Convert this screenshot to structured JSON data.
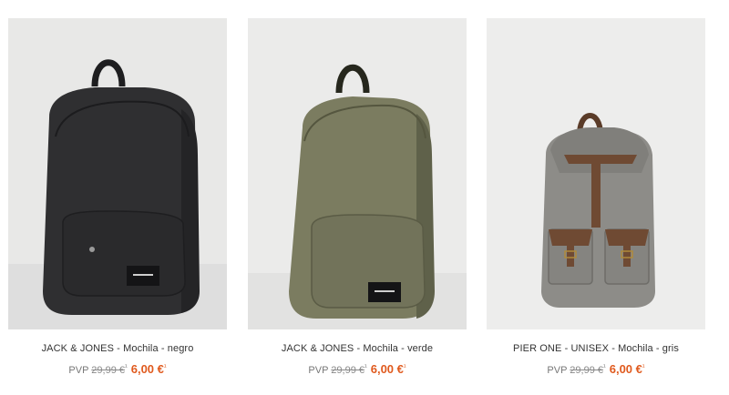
{
  "products": [
    {
      "name": "JACK & JONES - Mochila - negro",
      "pvp_label": "PVP",
      "old_price": "29,99 €",
      "new_price": "6,00 €",
      "marker": "¹",
      "colors": {
        "bg": "#e9e9e8",
        "body": "#2f2f31",
        "shade": "#242426"
      }
    },
    {
      "name": "JACK & JONES - Mochila - verde",
      "pvp_label": "PVP",
      "old_price": "29,99 €",
      "new_price": "6,00 €",
      "marker": "¹",
      "colors": {
        "bg": "#ececeb",
        "body": "#7b7c60",
        "shade": "#5f614a"
      }
    },
    {
      "name": "PIER ONE - UNISEX - Mochila - gris",
      "pvp_label": "PVP",
      "old_price": "29,99 €",
      "new_price": "6,00 €",
      "marker": "¹",
      "colors": {
        "bg": "#ededec",
        "body": "#8d8c88",
        "shade": "#6e6d69",
        "leather": "#6f4a33"
      }
    }
  ]
}
